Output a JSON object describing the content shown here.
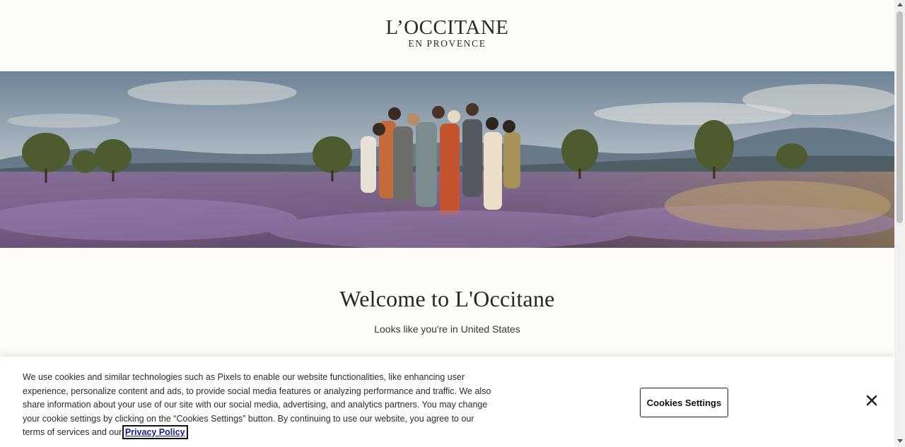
{
  "header": {
    "logo_main": "L’OCCITANE",
    "logo_sub": "EN PROVENCE"
  },
  "hero": {
    "image_description": "group-photo-lavender-field"
  },
  "welcome": {
    "title": "Welcome to L'Occitane",
    "subtitle": "Looks like you're in United States"
  },
  "cookie_banner": {
    "text": "We use cookies and similar technologies such as Pixels to enable our website functionalities, like enhancing user experience, personalize content and ads, to provide social media features or analyzing performance and traffic. We also share information about your use of our site with our social media, advertising, and analytics partners. You may change your cookie settings by clicking on the “Cookies Settings” button. By continuing to use our website, you agree to our terms of services and our",
    "privacy_link": "Privacy Policy",
    "settings_button": "Cookies Settings",
    "close_icon": "close-icon"
  },
  "colors": {
    "background": "#fdfcf9",
    "text": "#2b2623",
    "lavender": "#8a6fa8",
    "sky": "#9fb0bf"
  }
}
